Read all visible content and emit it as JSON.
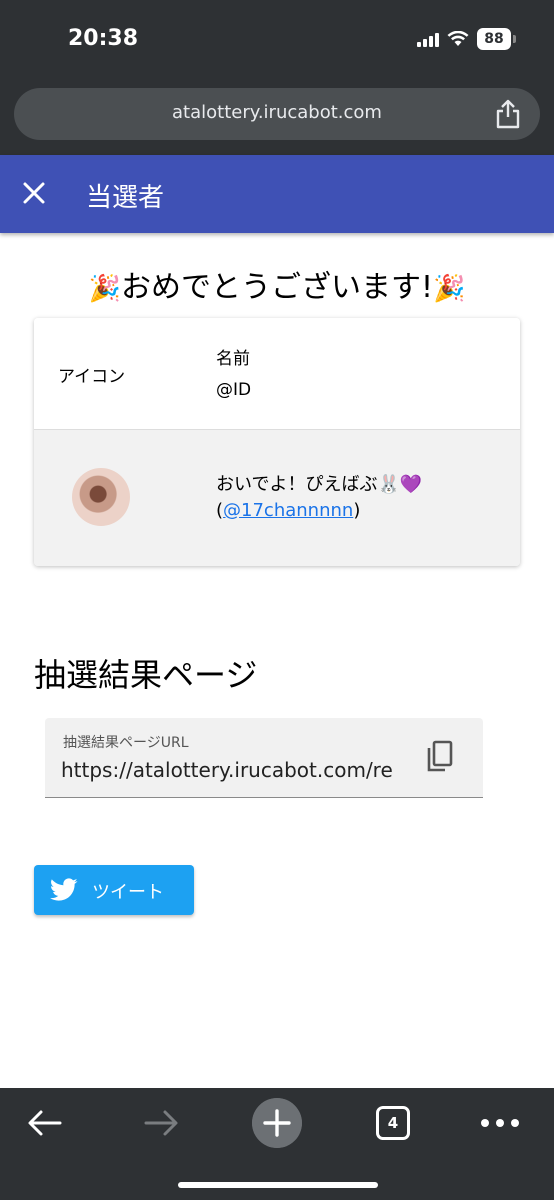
{
  "status_bar": {
    "time": "20:38",
    "battery": "88"
  },
  "browser": {
    "url": "atalottery.irucabot.com",
    "tab_count": "4"
  },
  "appbar": {
    "title": "当選者"
  },
  "congrats": {
    "text": "おめでとうございます!"
  },
  "table": {
    "header_icon": "アイコン",
    "header_name": "名前",
    "header_id": "@ID",
    "rows": [
      {
        "name": "おいでよ！ぴえばぶ🐰💜",
        "id_open": "(",
        "id": "@17channnnn",
        "id_close": ")"
      }
    ]
  },
  "result_section": {
    "title": "抽選結果ページ",
    "field_label": "抽選結果ページURL",
    "field_value": "https://atalottery.irucabot.com/re"
  },
  "tweet_button": {
    "label": "ツイート"
  },
  "colors": {
    "appbar": "#3f51b5",
    "tweet": "#1da1f2",
    "link": "#1a73e8",
    "chrome": "#2e3134"
  }
}
